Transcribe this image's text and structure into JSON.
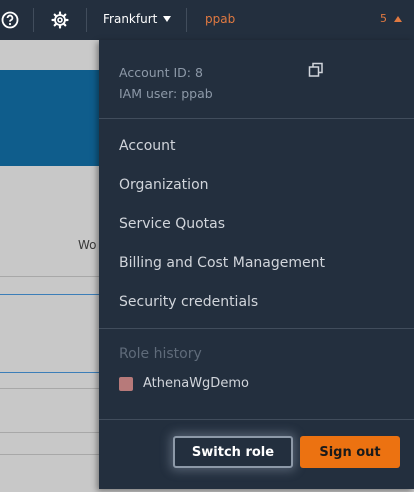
{
  "topbar": {
    "region": "Frankfurt",
    "account_name": "ppab",
    "account_count": "5",
    "icons": [
      "help-icon",
      "settings-icon"
    ]
  },
  "background": {
    "partial_text": "Wo"
  },
  "dropdown": {
    "account_id_label": "Account ID: 8",
    "iam_user_label": "IAM user: ppab",
    "menu_items": [
      "Account",
      "Organization",
      "Service Quotas",
      "Billing and Cost Management",
      "Security credentials"
    ],
    "role_history_heading": "Role history",
    "role_history_items": [
      {
        "name": "AthenaWgDemo",
        "color": "#b77a7a"
      }
    ],
    "switch_role_label": "Switch role",
    "sign_out_label": "Sign out"
  },
  "colors": {
    "nav_background": "#232f3e",
    "account_accent": "#e07941",
    "sign_out_button": "#ec7211"
  }
}
